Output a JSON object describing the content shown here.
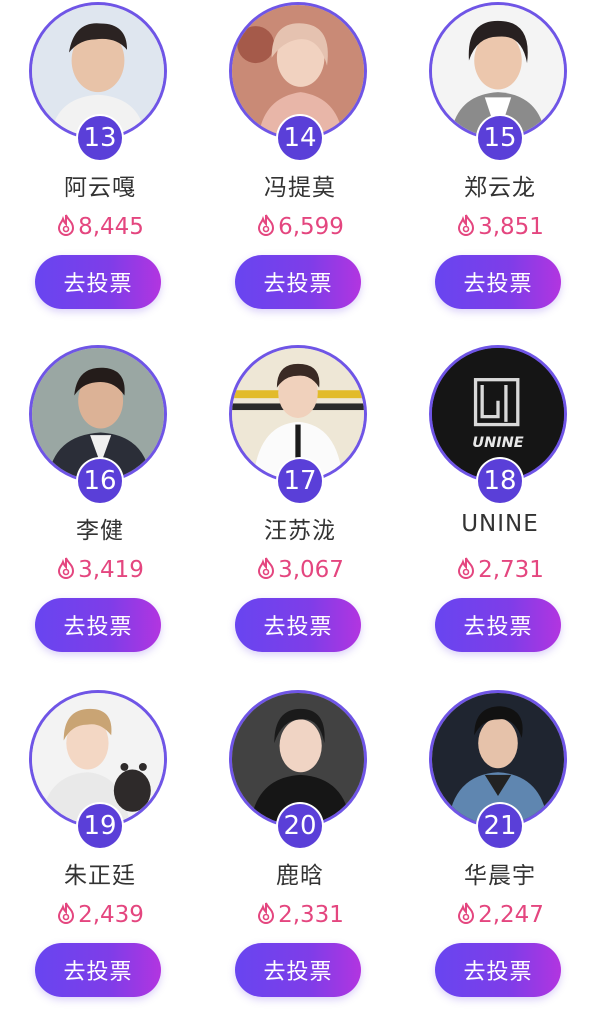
{
  "colors": {
    "ring": "#6f55e6",
    "badge": "#5a3fd8",
    "vote_text": "#e4467f",
    "button_start": "#6845f0",
    "button_end": "#b235e0"
  },
  "icons": {
    "vote_count": "flame-icon"
  },
  "candidates": [
    {
      "rank": "13",
      "name": "阿云嘎",
      "votes": "8,445",
      "button_label": "去投票"
    },
    {
      "rank": "14",
      "name": "冯提莫",
      "votes": "6,599",
      "button_label": "去投票"
    },
    {
      "rank": "15",
      "name": "郑云龙",
      "votes": "3,851",
      "button_label": "去投票"
    },
    {
      "rank": "16",
      "name": "李健",
      "votes": "3,419",
      "button_label": "去投票"
    },
    {
      "rank": "17",
      "name": "汪苏泷",
      "votes": "3,067",
      "button_label": "去投票"
    },
    {
      "rank": "18",
      "name": "UNINE",
      "votes": "2,731",
      "button_label": "去投票",
      "logo_text": "UNINE"
    },
    {
      "rank": "19",
      "name": "朱正廷",
      "votes": "2,439",
      "button_label": "去投票"
    },
    {
      "rank": "20",
      "name": "鹿晗",
      "votes": "2,331",
      "button_label": "去投票"
    },
    {
      "rank": "21",
      "name": "华晨宇",
      "votes": "2,247",
      "button_label": "去投票"
    }
  ]
}
